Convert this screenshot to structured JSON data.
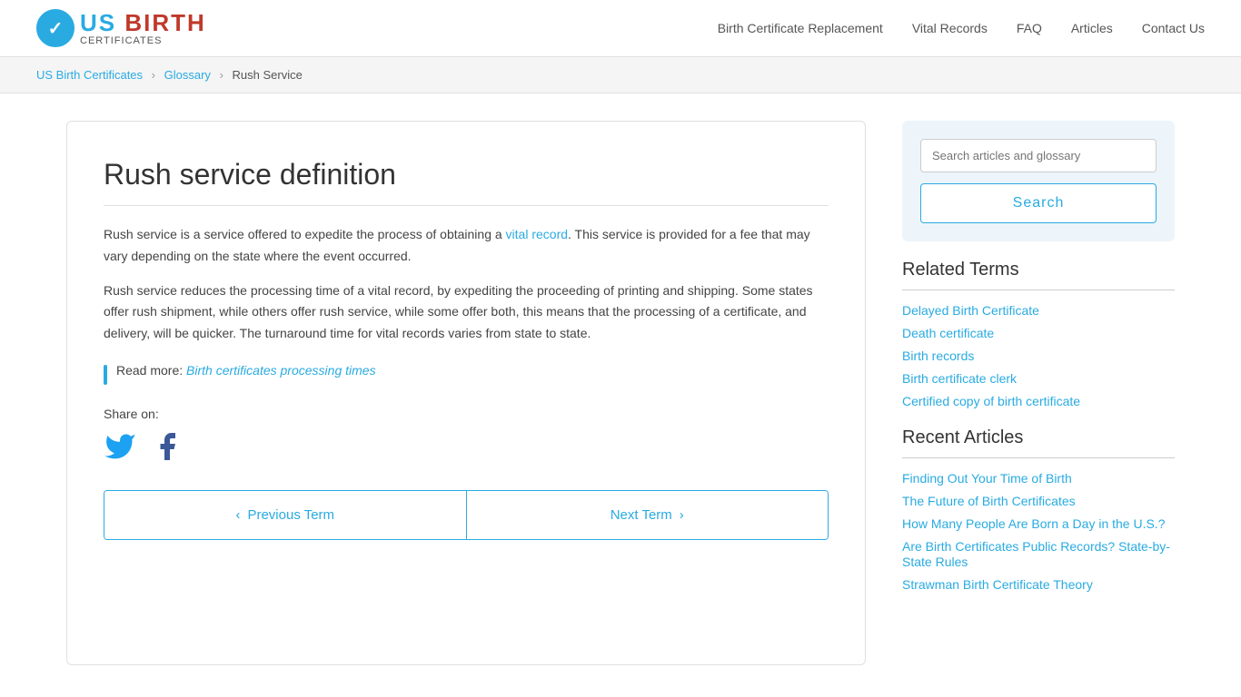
{
  "header": {
    "logo_alt": "US Birth Certificates",
    "nav": [
      {
        "label": "Birth Certificate Replacement",
        "href": "#"
      },
      {
        "label": "Vital Records",
        "href": "#"
      },
      {
        "label": "FAQ",
        "href": "#"
      },
      {
        "label": "Articles",
        "href": "#"
      },
      {
        "label": "Contact Us",
        "href": "#"
      }
    ]
  },
  "breadcrumb": {
    "items": [
      {
        "label": "US Birth Certificates",
        "href": "#"
      },
      {
        "label": "Glossary",
        "href": "#"
      },
      {
        "label": "Rush Service",
        "href": null
      }
    ]
  },
  "main": {
    "title": "Rush service definition",
    "paragraphs": [
      {
        "text_before": "Rush service is a service offered to expedite the process of obtaining a ",
        "link_text": "vital record",
        "link_href": "#",
        "text_after": ". This service is provided for a fee that may vary depending on the state where the event occurred."
      },
      {
        "text": "Rush service reduces the processing time of a vital record, by expediting the proceeding of printing and shipping. Some states offer rush shipment, while others offer rush service, while some offer both, this means that the processing of a certificate, and delivery, will be quicker. The turnaround time for vital records varies from state to state."
      }
    ],
    "read_more_label": "Read more:",
    "read_more_link_text": "Birth certificates processing times",
    "read_more_link_href": "#",
    "share_label": "Share on:",
    "prev_term_label": "Previous Term",
    "next_term_label": "Next Term"
  },
  "sidebar": {
    "search_placeholder": "Search articles and glossary",
    "search_button_label": "Search",
    "related_terms_title": "Related Terms",
    "related_terms": [
      {
        "label": "Delayed Birth Certificate",
        "href": "#"
      },
      {
        "label": "Death certificate",
        "href": "#"
      },
      {
        "label": "Birth records",
        "href": "#"
      },
      {
        "label": "Birth certificate clerk",
        "href": "#"
      },
      {
        "label": "Certified copy of birth certificate",
        "href": "#"
      }
    ],
    "recent_articles_title": "Recent Articles",
    "recent_articles": [
      {
        "label": "Finding Out Your Time of Birth",
        "href": "#"
      },
      {
        "label": "The Future of Birth Certificates",
        "href": "#"
      },
      {
        "label": "How Many People Are Born a Day in the U.S.?",
        "href": "#"
      },
      {
        "label": "Are Birth Certificates Public Records? State-by-State Rules",
        "href": "#"
      },
      {
        "label": "Strawman Birth Certificate Theory",
        "href": "#"
      }
    ]
  }
}
